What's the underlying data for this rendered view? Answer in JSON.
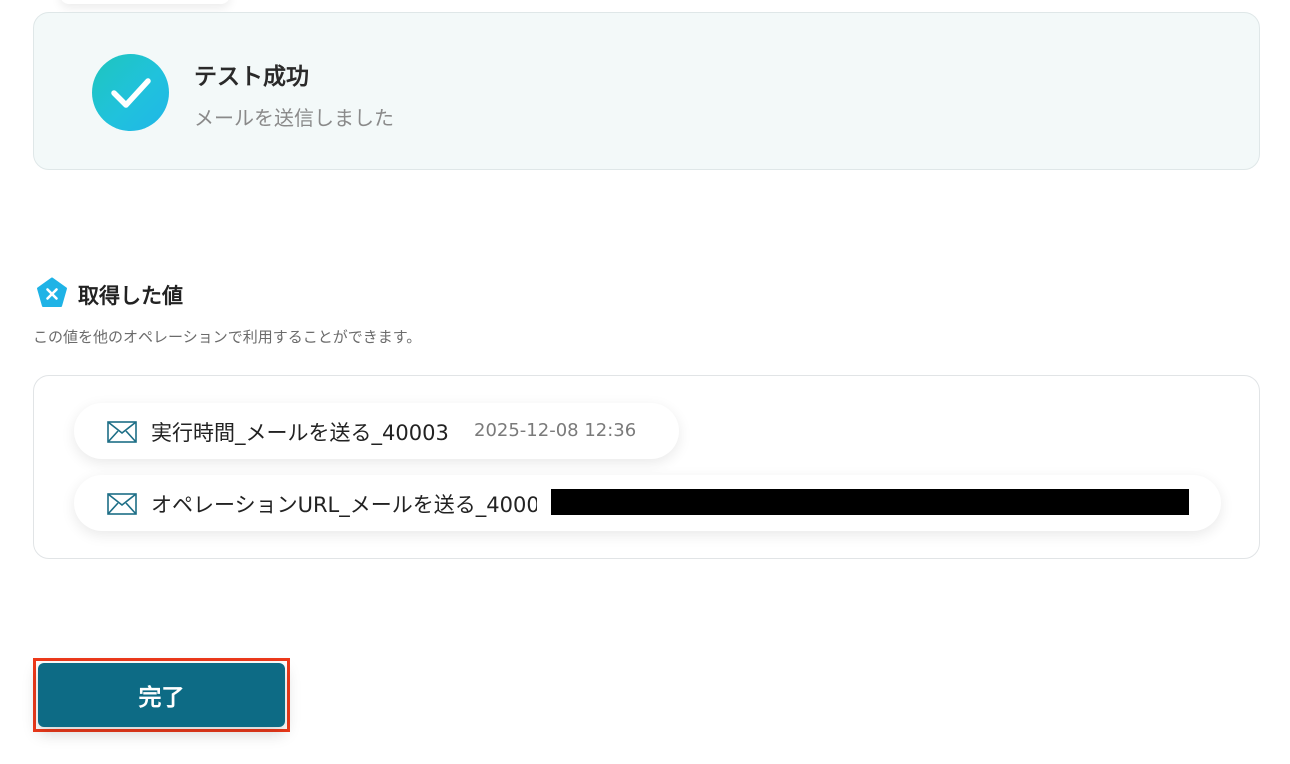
{
  "success": {
    "title": "テスト成功",
    "subtitle": "メールを送信しました",
    "icon": "check-circle-icon",
    "gradient": [
      "#1ec5bd",
      "#1fb6e8"
    ]
  },
  "acquired": {
    "title": "取得した値",
    "description": "この値を他のオペレーションで利用することができます。",
    "icon": "yoom-logo-icon",
    "items": [
      {
        "icon": "mail-icon",
        "label": "実行時間_メールを送る_40003",
        "value": "2025-12-08 12:36",
        "redacted": false
      },
      {
        "icon": "mail-icon",
        "label": "オペレーションURL_メールを送る_4000",
        "value": "",
        "redacted": true
      }
    ]
  },
  "actions": {
    "done_label": "完了",
    "done_color": "#0d6b85",
    "highlight_color": "#ee3a1b"
  }
}
